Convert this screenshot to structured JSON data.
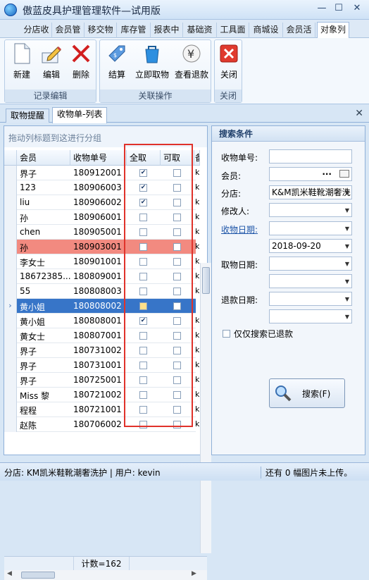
{
  "window": {
    "title": "傲蓝皮具护理管理软件—试用版"
  },
  "menu_tabs": [
    "分店收",
    "会员管",
    "移交物",
    "库存管",
    "报表中",
    "基础资",
    "工具面",
    "商城设",
    "会员活",
    "对象列"
  ],
  "ribbon": {
    "groups": [
      {
        "label": "记录编辑",
        "buttons": [
          "新建",
          "编辑",
          "删除"
        ]
      },
      {
        "label": "关联操作",
        "buttons": [
          "结算",
          "立即取物",
          "查看退款"
        ]
      },
      {
        "label": "关闭",
        "buttons": [
          "关闭"
        ]
      }
    ]
  },
  "doc_tabs": [
    "取物提醒",
    "收物单-列表"
  ],
  "grid": {
    "group_hint": "拖动列标题到这进行分组",
    "columns": [
      "会员",
      "收物单号",
      "全取",
      "可取",
      "备"
    ],
    "rows": [
      {
        "member": "界子",
        "order": "180912001",
        "all": true,
        "can": false,
        "note": "k"
      },
      {
        "member": "123",
        "order": "180906003",
        "all": true,
        "can": false,
        "note": "k"
      },
      {
        "member": "liu",
        "order": "180906002",
        "all": true,
        "can": false,
        "note": "k"
      },
      {
        "member": "孙",
        "order": "180906001",
        "all": false,
        "can": false,
        "note": "k"
      },
      {
        "member": "chen",
        "order": "180905001",
        "all": false,
        "can": false,
        "note": "k"
      },
      {
        "member": "孙",
        "order": "180903001",
        "all": false,
        "can": false,
        "note": "k"
      },
      {
        "member": "李女士",
        "order": "180901001",
        "all": false,
        "can": false,
        "note": "k"
      },
      {
        "member": "18672385...",
        "order": "180809001",
        "all": false,
        "can": false,
        "note": "k"
      },
      {
        "member": "55",
        "order": "180808003",
        "all": false,
        "can": false,
        "note": "k"
      },
      {
        "member": "黄小姐",
        "order": "180808002",
        "all": false,
        "can": false,
        "note": "k"
      },
      {
        "member": "黄小姐",
        "order": "180808001",
        "all": true,
        "can": false,
        "note": "k"
      },
      {
        "member": "黄女士",
        "order": "180807001",
        "all": false,
        "can": false,
        "note": "k"
      },
      {
        "member": "界子",
        "order": "180731002",
        "all": false,
        "can": false,
        "note": "k"
      },
      {
        "member": "界子",
        "order": "180731001",
        "all": false,
        "can": false,
        "note": "k"
      },
      {
        "member": "界子",
        "order": "180725001",
        "all": false,
        "can": false,
        "note": "k"
      },
      {
        "member": "Miss 黎",
        "order": "180721002",
        "all": false,
        "can": false,
        "note": "k"
      },
      {
        "member": "程程",
        "order": "180721001",
        "all": false,
        "can": false,
        "note": "k"
      },
      {
        "member": "赵陈",
        "order": "180706002",
        "all": false,
        "can": false,
        "note": "k"
      }
    ],
    "count": "计数=162"
  },
  "search": {
    "title": "搜索条件",
    "labels": {
      "order_no": "收物单号:",
      "member": "会员:",
      "branch": "分店:",
      "modifier": "修改人:",
      "receive_date": "收物日期:",
      "pickup_date": "取物日期:",
      "refund_date": "退款日期:"
    },
    "branch_value": "K&M凯米鞋靴潮奢洗",
    "member_ellipsis": "···",
    "receive_date_to": "2018-09-20",
    "refund_only_label": "仅仅搜索已退款",
    "button": "搜索(F)"
  },
  "statusbar": {
    "left": "分店: KM凯米鞋靴潮奢洗护 | 用户: kevin",
    "right": "还有 0 幅图片未上传。"
  }
}
